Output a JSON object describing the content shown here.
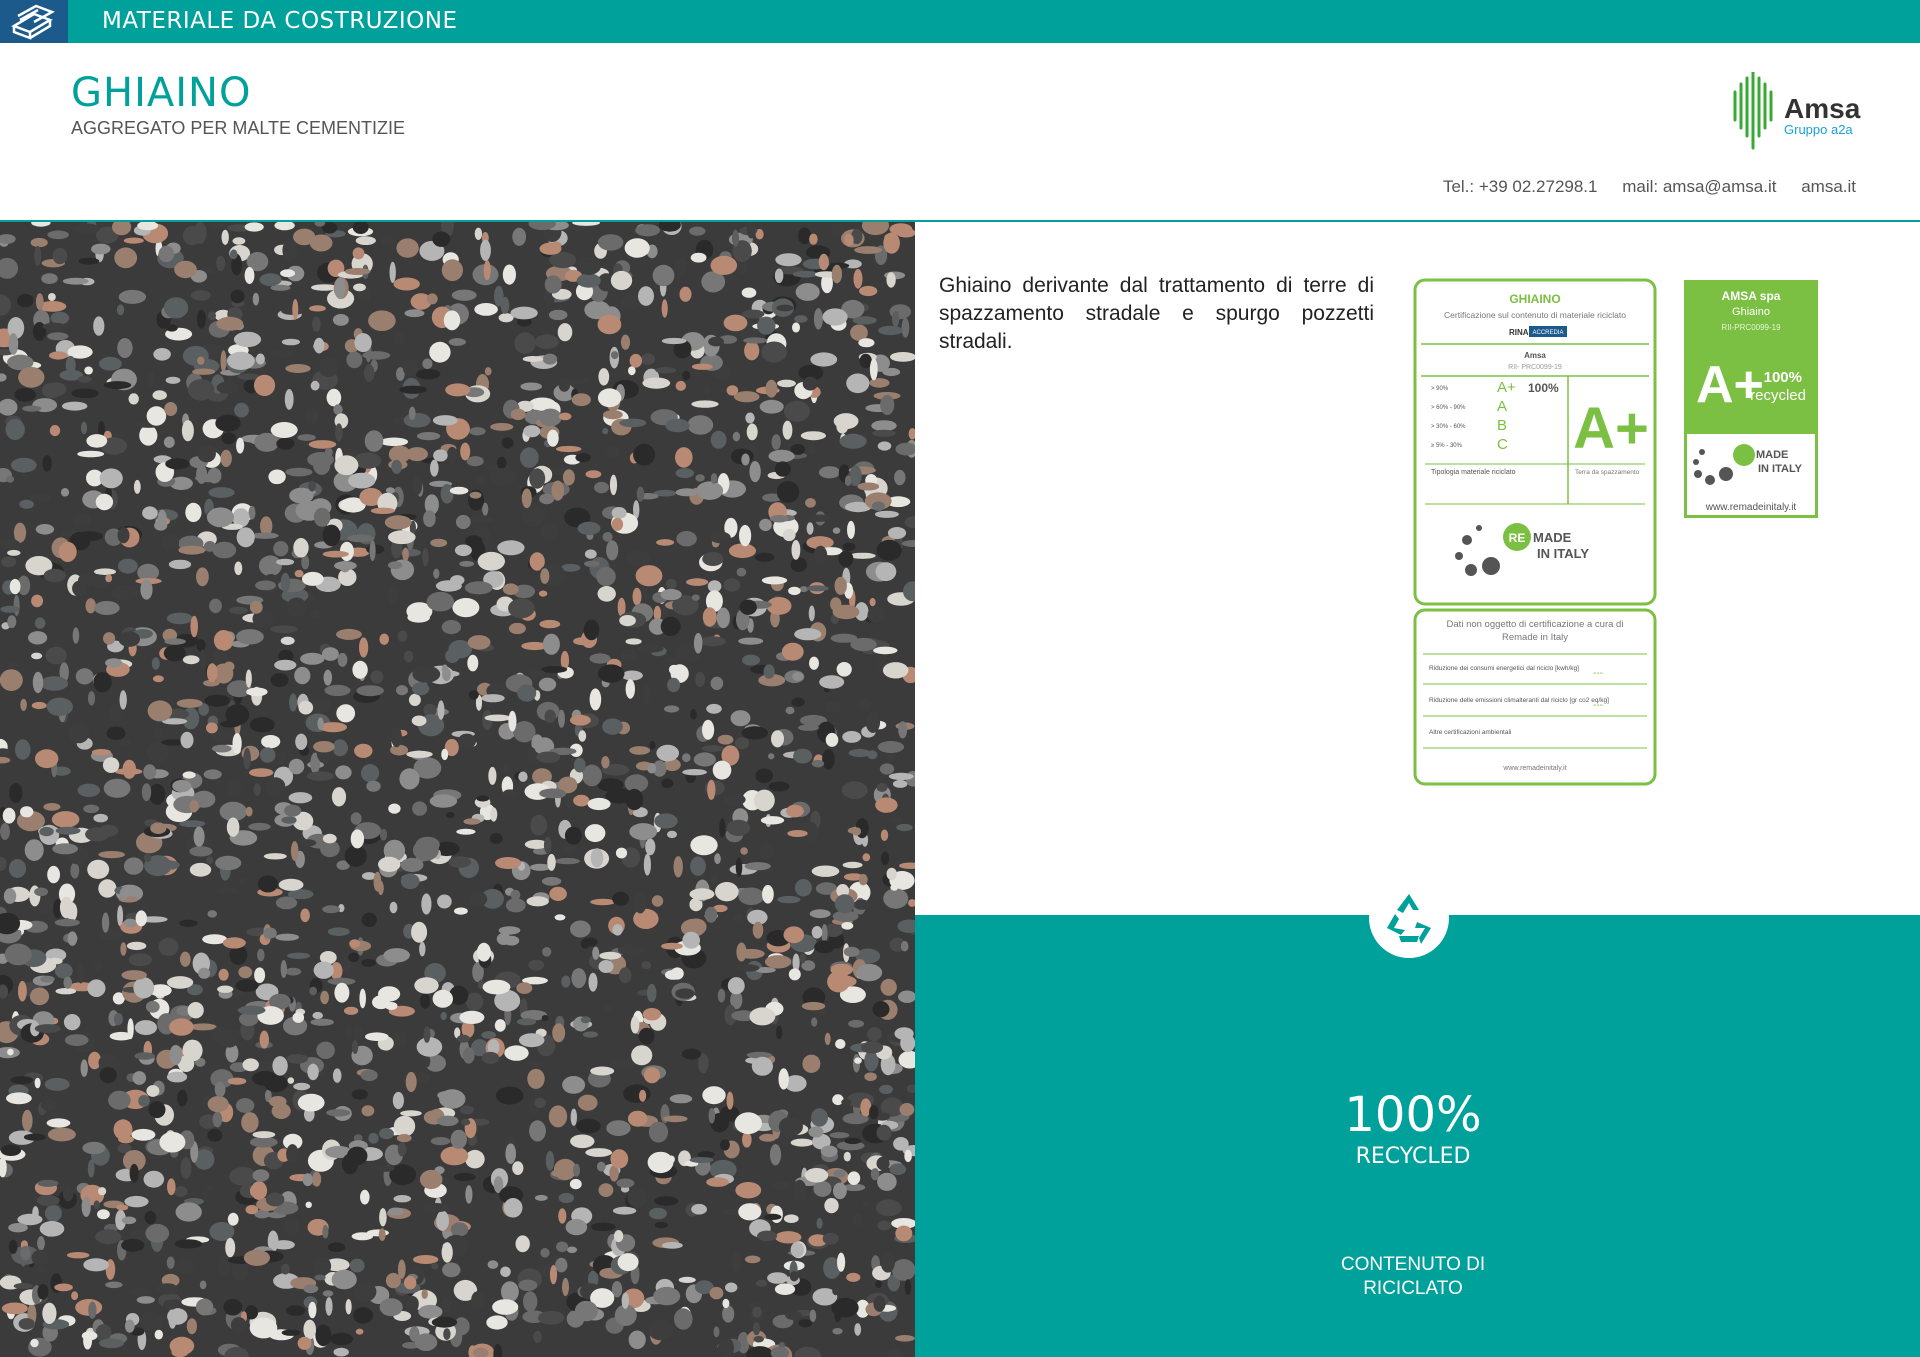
{
  "header": {
    "category": "MATERIALE DA COSTRUZIONE",
    "title": "GHIAINO",
    "subtitle": "AGGREGATO PER MALTE CEMENTIZIE"
  },
  "logo": {
    "name": "Amsa",
    "group": "Gruppo a2a"
  },
  "contacts": {
    "tel": "Tel.: +39 02.27298.1",
    "mail": "mail: amsa@amsa.it",
    "web": "amsa.it"
  },
  "description": "Ghiaino derivante dal trattamento di terre di spazzamento stradale e spurgo pozzetti stradali.",
  "certificate": {
    "product": "GHIAINO",
    "heading": "Certificazione sul contenuto di materiale riciclato",
    "company": "Amsa",
    "code": "RII- PRC0099-19",
    "rows": [
      {
        "range": "> 90%",
        "class": "A+"
      },
      {
        "range": "> 60% - 90%",
        "class": "A"
      },
      {
        "range": "> 30% - 60%",
        "class": "B"
      },
      {
        "range": "≥ 5% - 30%",
        "class": "C"
      }
    ],
    "percent": "100%",
    "grade": "A+",
    "material_label": "Tipologia materiale riciclato",
    "material_value": "Terra da spazzamento",
    "brand_re": "RE",
    "brand_made": "MADE",
    "brand_italy": "IN ITALY",
    "note": "Dati non oggetto di certificazione a cura di Remade in Italy",
    "note_rows": [
      "Riduzione dei consumi energetici dal riciclo [kwh/kg]",
      "Riduzione delle emissioni climalteranti dal riciclo [gr co2 eq/kg]",
      "Altre certificazioni ambientali"
    ],
    "dash": "---",
    "website": "www.remadeinitaly.it",
    "registry_1": "RINA",
    "registry_2": "ACCREDIA"
  },
  "small_label": {
    "company": "AMSA spa",
    "product": "Ghiaino",
    "code": "RII-PRC0099-19",
    "grade": "A+",
    "percent": "100%",
    "recycled": "recycled",
    "website": "www.remadeinitaly.it"
  },
  "stats": {
    "percent": "100%",
    "recycled": "RECYCLED",
    "content": "CONTENUTO DI RICICLATO"
  },
  "colors": {
    "teal": "#00a19a",
    "green": "#7bc043",
    "navy": "#1d5a8c"
  }
}
